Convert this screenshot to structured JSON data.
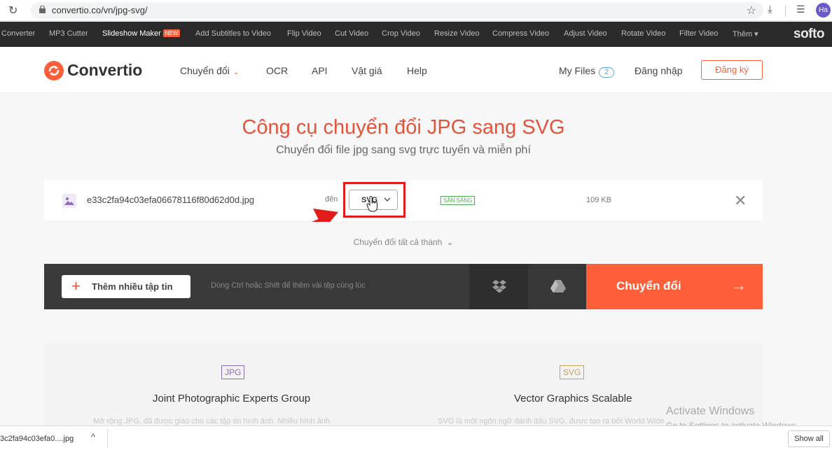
{
  "browser": {
    "url": "convertio.co/vn/jpg-svg/",
    "avatar": "Ha",
    "icons": [
      "reload-icon",
      "lock-icon",
      "star-icon",
      "download-icon",
      "queue-icon"
    ]
  },
  "softo_nav": {
    "items": [
      "Converter",
      "MP3 Cutter",
      "Slideshow Maker",
      "Add Subtitles to Video",
      "Flip Video",
      "Cut Video",
      "Crop Video",
      "Resize Video",
      "Compress Video",
      "Adjust Video",
      "Rotate Video",
      "Filter Video",
      "Thêm ▾"
    ],
    "new_badge": "NEW",
    "logo": "softo"
  },
  "header": {
    "logo": "Convertio",
    "nav": [
      "Chuyển đổi",
      "OCR",
      "API",
      "Vật giá",
      "Help"
    ],
    "chevron": "⌄",
    "my_files": "My Files",
    "my_files_count": "2",
    "login": "Đăng nhập",
    "signup": "Đăng ký"
  },
  "main": {
    "title": "Công cụ chuyển đổi JPG sang SVG",
    "subtitle": "Chuyển đổi file jpg sang svg trực tuyến và miễn phí"
  },
  "file_row": {
    "filename": "e33c2fa94c03efa06678116f80d62d0d.jpg",
    "to_label": "đến",
    "format": "SVG",
    "status": "SẴN SÀNG",
    "size": "109 KB",
    "close": "✕"
  },
  "convert_all": {
    "label": "Chuyển đổi tất cả thành",
    "chevron": "⌄"
  },
  "action_bar": {
    "add_label": "Thêm nhiều tập tin",
    "add_plus": "+",
    "hint": "Dùng Ctrl hoặc Shift để thêm vài tệp cùng lúc",
    "convert_label": "Chuyển đổi",
    "convert_arrow": "→"
  },
  "info": {
    "jpg_badge": "JPG",
    "jpg_title": "Joint Photographic Experts Group",
    "jpg_desc": "Mở rộng JPG, đã được giao cho các tập tin hình ảnh. Nhiều hình ảnh",
    "svg_badge": "SVG",
    "svg_title": "Vector Graphics Scalable",
    "svg_desc": "SVG là một ngôn ngữ đánh dấu SVG, được tạo ra bởi World Wide"
  },
  "watermark": {
    "line1": "Activate Windows",
    "line2": "Go to Settings to activate Windows."
  },
  "download_bar": {
    "file": "3c2fa94c03efa0....jpg",
    "chevron": "^",
    "show_all": "Show all"
  },
  "colors": {
    "brand": "#ff5e3a",
    "title": "#e4543a",
    "highlight": "#e21b1b",
    "ready": "#4caf50"
  }
}
